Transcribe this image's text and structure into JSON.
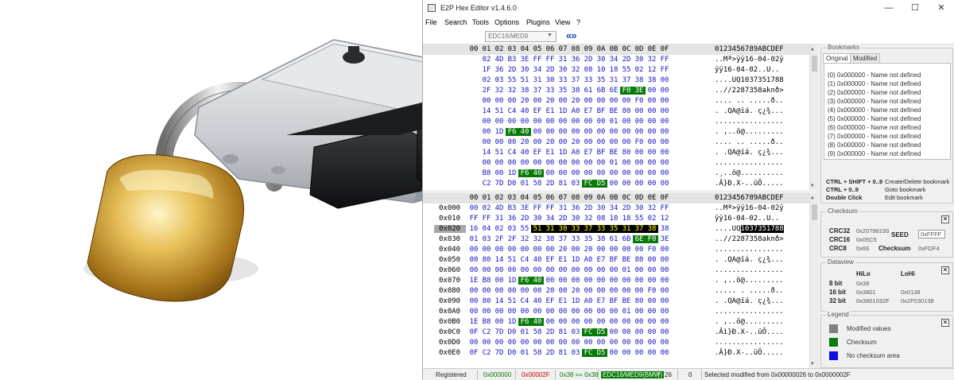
{
  "window": {
    "title": "E2P Hex Editor v1.4.6.0",
    "minimize": "—",
    "maximize": "☐",
    "close": "✕"
  },
  "menu": [
    "File",
    "Search",
    "Tools",
    "Options",
    "Plugins",
    "View",
    "?"
  ],
  "toolbar": {
    "ecu_select": "EDC16/MED9",
    "nav_arrows": "«»"
  },
  "hex": {
    "header_prefix": "00",
    "columns": [
      "01",
      "02",
      "03",
      "04",
      "05",
      "06",
      "07",
      "08",
      "09",
      "0A",
      "0B",
      "0C",
      "0D",
      "0E",
      "0F"
    ],
    "ascii_header": "0123456789ABCDEF",
    "pane1_columns": [
      "01",
      "02",
      "03",
      "04",
      "05",
      "06",
      "07",
      "08",
      "09",
      "0A",
      "0B",
      "0C",
      "0D",
      "0E",
      "0F"
    ],
    "pane1_rows": [
      {
        "bytes": [
          "02",
          "4D",
          "B3",
          "3E",
          "FF",
          "FF",
          "31",
          "36",
          "2D",
          "30",
          "34",
          "2D",
          "30",
          "32",
          "FF"
        ],
        "ascii": "..Mª>ÿÿ16-04-02ÿ"
      },
      {
        "bytes": [
          "1F",
          "36",
          "2D",
          "30",
          "34",
          "2D",
          "30",
          "32",
          "08",
          "10",
          "18",
          "55",
          "02",
          "12",
          "FF"
        ],
        "ascii": "ÿÿ16-04-02..U.."
      },
      {
        "bytes": [
          "02",
          "03",
          "55",
          "51",
          "31",
          "30",
          "33",
          "37",
          "33",
          "35",
          "31",
          "37",
          "38",
          "38",
          "00"
        ],
        "ascii": "....UQ1037351788"
      },
      {
        "bytes": [
          "2F",
          "32",
          "32",
          "38",
          "37",
          "33",
          "35",
          "38",
          "61",
          "6B",
          "6E",
          "F0",
          "3E",
          "00",
          "00"
        ],
        "ascii": "..//2287358aknð>"
      },
      {
        "bytes": [
          "00",
          "00",
          "00",
          "20",
          "00",
          "20",
          "00",
          "20",
          "00",
          "00",
          "00",
          "00",
          "F0",
          "00",
          "00"
        ],
        "ascii": ".... .. .....ð.."
      },
      {
        "bytes": [
          "14",
          "51",
          "C4",
          "40",
          "EF",
          "E1",
          "1D",
          "A0",
          "E7",
          "BF",
          "BE",
          "80",
          "00",
          "00",
          "00"
        ],
        "ascii": ". .QA@ïá. ç¿¾..."
      },
      {
        "bytes": [
          "00",
          "00",
          "00",
          "00",
          "00",
          "00",
          "00",
          "00",
          "00",
          "00",
          "01",
          "00",
          "00",
          "00",
          "00"
        ],
        "ascii": "................"
      },
      {
        "bytes": [
          "00",
          "1D",
          "F6",
          "40",
          "00",
          "00",
          "00",
          "00",
          "00",
          "00",
          "00",
          "00",
          "00",
          "00",
          "00"
        ],
        "ascii": ". ,..ö@........."
      },
      {
        "bytes": [
          "00",
          "00",
          "00",
          "20",
          "00",
          "20",
          "00",
          "20",
          "00",
          "00",
          "00",
          "00",
          "F0",
          "00",
          "00"
        ],
        "ascii": ".... .. .....ð.."
      },
      {
        "bytes": [
          "14",
          "51",
          "C4",
          "40",
          "EF",
          "E1",
          "1D",
          "A0",
          "E7",
          "BF",
          "BE",
          "80",
          "00",
          "00",
          "00"
        ],
        "ascii": ". .QA@ïá. ç¿¾..."
      },
      {
        "bytes": [
          "00",
          "00",
          "00",
          "00",
          "00",
          "00",
          "00",
          "00",
          "00",
          "00",
          "01",
          "00",
          "00",
          "00",
          "00"
        ],
        "ascii": "................"
      },
      {
        "bytes": [
          "B8",
          "00",
          "1D",
          "F6",
          "40",
          "00",
          "00",
          "00",
          "00",
          "00",
          "00",
          "00",
          "00",
          "00",
          "00"
        ],
        "ascii": ".¸..ö@.........."
      },
      {
        "bytes": [
          "C2",
          "7D",
          "D0",
          "01",
          "58",
          "2D",
          "81",
          "03",
          "FC",
          "D5",
          "00",
          "00",
          "00",
          "00",
          "00"
        ],
        "ascii": ".Â}Ð.X-..üÕ....."
      }
    ],
    "pane2_rows": [
      {
        "addr": "0x000",
        "bytes": [
          "02",
          "4D",
          "B3",
          "3E",
          "FF",
          "FF",
          "31",
          "36",
          "2D",
          "30",
          "34",
          "2D",
          "30",
          "32",
          "FF"
        ],
        "first": "00",
        "ascii": "..Mª>ÿÿ16-04-02ÿ"
      },
      {
        "addr": "0x010",
        "bytes": [
          "FF",
          "31",
          "36",
          "2D",
          "30",
          "34",
          "2D",
          "30",
          "32",
          "08",
          "10",
          "18",
          "55",
          "02",
          "12"
        ],
        "first": "FF",
        "ascii": "ÿÿ16-04-02..U.."
      },
      {
        "addr": "0x020",
        "bytes": [
          "04",
          "02",
          "03",
          "55",
          "51",
          "31",
          "30",
          "33",
          "37",
          "33",
          "35",
          "31",
          "37",
          "38",
          "38"
        ],
        "first": "16",
        "ascii": "....UQ",
        "ascii_sel": "1037351788"
      },
      {
        "addr": "0x030",
        "bytes": [
          "03",
          "2F",
          "2F",
          "32",
          "32",
          "38",
          "37",
          "33",
          "35",
          "38",
          "61",
          "6B",
          "6E",
          "F0",
          "3E"
        ],
        "first": "01",
        "ascii": "..//2287358aknð>"
      },
      {
        "addr": "0x040",
        "bytes": [
          "00",
          "00",
          "00",
          "00",
          "00",
          "00",
          "20",
          "00",
          "20",
          "00",
          "00",
          "00",
          "00",
          "F0",
          "00"
        ],
        "first": "00",
        "ascii": "................"
      },
      {
        "addr": "0x050",
        "bytes": [
          "80",
          "14",
          "51",
          "C4",
          "40",
          "EF",
          "E1",
          "1D",
          "A0",
          "E7",
          "BF",
          "BE",
          "80",
          "00",
          "00"
        ],
        "first": "00",
        "ascii": ". .QA@ïá. ç¿¾..."
      },
      {
        "addr": "0x060",
        "bytes": [
          "00",
          "00",
          "00",
          "00",
          "00",
          "00",
          "00",
          "00",
          "00",
          "00",
          "00",
          "01",
          "00",
          "00",
          "00"
        ],
        "first": "00",
        "ascii": "................"
      },
      {
        "addr": "0x070",
        "bytes": [
          "B8",
          "00",
          "1D",
          "F6",
          "40",
          "00",
          "00",
          "00",
          "00",
          "00",
          "00",
          "00",
          "00",
          "00",
          "00"
        ],
        "first": "1E",
        "ascii": ". ,..ö@........."
      },
      {
        "addr": "0x080",
        "bytes": [
          "00",
          "00",
          "00",
          "00",
          "00",
          "20",
          "00",
          "20",
          "00",
          "00",
          "00",
          "00",
          "00",
          "F0",
          "00"
        ],
        "first": "00",
        "ascii": "..... . .....ð.."
      },
      {
        "addr": "0x090",
        "bytes": [
          "80",
          "14",
          "51",
          "C4",
          "40",
          "EF",
          "E1",
          "1D",
          "A0",
          "E7",
          "BF",
          "BE",
          "80",
          "00",
          "00"
        ],
        "first": "00",
        "ascii": ". .QA@ïá. ç¿¾..."
      },
      {
        "addr": "0x0A0",
        "bytes": [
          "00",
          "00",
          "00",
          "00",
          "00",
          "00",
          "00",
          "00",
          "00",
          "00",
          "00",
          "01",
          "00",
          "00",
          "00"
        ],
        "first": "00",
        "ascii": "................"
      },
      {
        "addr": "0x0B0",
        "bytes": [
          "B8",
          "00",
          "1D",
          "F6",
          "40",
          "00",
          "00",
          "00",
          "00",
          "00",
          "00",
          "00",
          "00",
          "00",
          "00"
        ],
        "first": "1E",
        "ascii": ". ,..ö@........."
      },
      {
        "addr": "0x0C0",
        "bytes": [
          "C2",
          "7D",
          "D0",
          "01",
          "58",
          "2D",
          "81",
          "03",
          "FC",
          "D5",
          "00",
          "00",
          "00",
          "00",
          "00"
        ],
        "first": "0F",
        "ascii": ".Âì}Ð.X-..üÕ...."
      },
      {
        "addr": "0x0D0",
        "bytes": [
          "00",
          "00",
          "00",
          "00",
          "00",
          "00",
          "00",
          "00",
          "00",
          "00",
          "00",
          "00",
          "00",
          "00",
          "00"
        ],
        "first": "00",
        "ascii": "................"
      },
      {
        "addr": "0x0E0",
        "bytes": [
          "C2",
          "7D",
          "D0",
          "01",
          "58",
          "2D",
          "81",
          "03",
          "FC",
          "D5",
          "00",
          "00",
          "00",
          "00",
          "00"
        ],
        "first": "0F",
        "ascii": ".Â}Ð.X-..üÕ....."
      }
    ],
    "colors": {
      "checksum": "#087a08",
      "modified": "#808080",
      "selection": "#000000",
      "hex_text": "#1414c8"
    }
  },
  "bookmarks": {
    "title": "Bookmarks",
    "tabs": [
      "Original",
      "Modified"
    ],
    "items": [
      "(0) 0x000000 - Name not defined",
      "(1) 0x000000 - Name not defined",
      "(2) 0x000000 - Name not defined",
      "(3) 0x000000 - Name not defined",
      "(4) 0x000000 - Name not defined",
      "(5) 0x000000 - Name not defined",
      "(6) 0x000000 - Name not defined",
      "(7) 0x000000 - Name not defined",
      "(8) 0x000000 - Name not defined",
      "(9) 0x000000 - Name not defined"
    ],
    "shortcuts": [
      {
        "key": "CTRL + SHIFT + 0..9",
        "desc": "Create/Delete bookmark"
      },
      {
        "key": "CTRL + 0..9",
        "desc": "Goto bookmark"
      },
      {
        "key": "Double Click",
        "desc": "Edit bookmark"
      }
    ]
  },
  "checksum": {
    "title": "Checksum",
    "close": "✕",
    "crc32_label": "CRC32",
    "crc32": "0x20798193",
    "seed_label": "SEED",
    "seed": "0xFFFF",
    "crc16_label": "CRC16",
    "crc16": "0x05C5",
    "crc8_label": "CRC8",
    "crc8": "0x66",
    "checksum_label": "Checksum",
    "checksum": "0xFDF4"
  },
  "dataview": {
    "title": "Dataview",
    "close": "✕",
    "col_hilo": "HiLo",
    "col_lohi": "LoHi",
    "rows": [
      {
        "label": "8 bit",
        "hilo": "0x38",
        "lohi": ""
      },
      {
        "label": "16 bit",
        "hilo": "0x3801",
        "lohi": "0x0138"
      },
      {
        "label": "32 bit",
        "hilo": "0x3801032F",
        "lohi": "0x2F030138"
      }
    ]
  },
  "legend": {
    "title": "Legend",
    "close": "✕",
    "items": [
      {
        "label": "Modified values",
        "color": "#808080"
      },
      {
        "label": "Checksum",
        "color": "#087a08"
      },
      {
        "label": "No checksum area",
        "color": "#1010e0"
      }
    ]
  },
  "status": {
    "state": "Registered",
    "start": "0x000000",
    "end": "0x00002F",
    "value": "0x38 == 0x38",
    "ecu": "EDC16/MED9(BMW)",
    "count": "26",
    "zero": "0",
    "message": "Selected modified from 0x00000026 to 0x0000002F"
  }
}
